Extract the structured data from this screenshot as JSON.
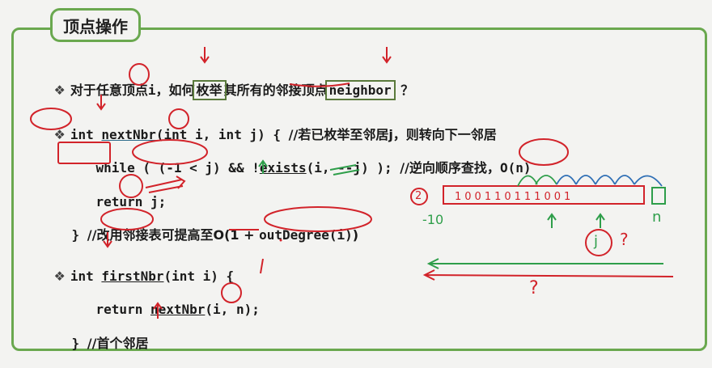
{
  "title": "顶点操作",
  "line1": {
    "bullet": "❖",
    "pre": "对于任意顶点",
    "var_i": "i",
    "mid": "，如何",
    "enum_word": "枚举",
    "post": "其所有的",
    "adj_word": "邻接顶点",
    "neighbor": "neighbor",
    "q": "？"
  },
  "line2": {
    "bullet": "❖",
    "int_kw": "int",
    "fn": "nextNbr",
    "args": "(int i, int j) { ",
    "comment": "//若已枚举至邻居j，则转向下一邻居"
  },
  "line3": {
    "while_kw": "while",
    "p1": " ( ",
    "cond": "(-1 < j)",
    "p2": " && !",
    "exists": "exists",
    "p3": "(i, --j) ); ",
    "comment": "//逆向顺序查找，",
    "big_o": "O(n)"
  },
  "line4": {
    "code": "return j;"
  },
  "line5": {
    "brace": "} ",
    "comment_pre": "//改用",
    "table_word": "邻接表",
    "comment_mid": "可提高至O(1 + ",
    "out_degree": "outDegree(i)",
    "comment_end": ")"
  },
  "line6": {
    "bullet": "❖",
    "pre": "int ",
    "fn": "firstNbr",
    "post": "(int i) {"
  },
  "line7": {
    "pre": "return ",
    "fn": "nextNbr",
    "args": "(i, n);"
  },
  "line8": {
    "brace": "} ",
    "comment": "//首个邻居"
  },
  "annotations": {
    "row_bits": "100110111001",
    "left_index": "2",
    "minus_ten": "-10",
    "n_label": "n",
    "j_label": "j",
    "question_1": "?",
    "question_2": "?",
    "exclamation": "!"
  },
  "colors": {
    "frame_green": "#6aa84f",
    "ink_red": "#d2232a",
    "ink_green": "#2e9e4a",
    "ink_blue": "#2f6fb5"
  }
}
